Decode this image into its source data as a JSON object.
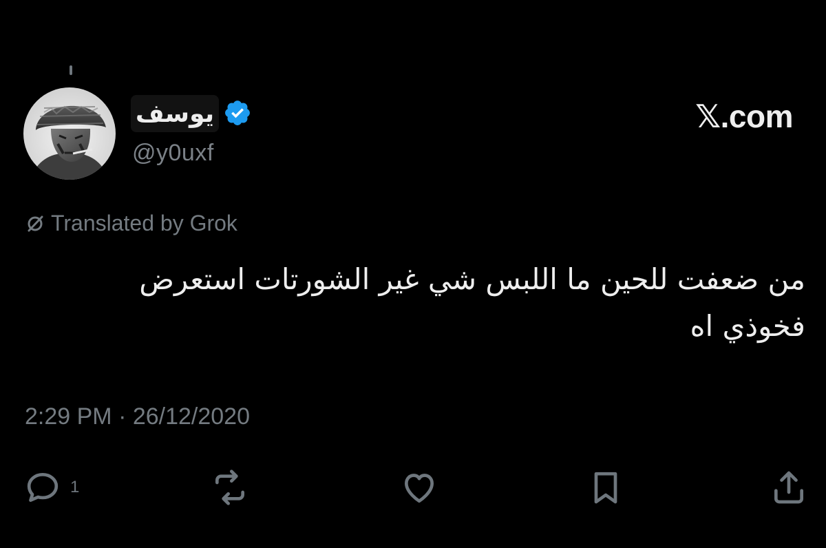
{
  "tweet": {
    "display_name": "يوسف",
    "handle": "@y0uxf",
    "verified": true,
    "brand": "𝕏.com",
    "translated_label": "Translated by Grok",
    "text": "من ضعفت للحين ما اللبس شي غير الشورتات استعرض فخوذي اه",
    "timestamp": "2:29 PM · 26/12/2020"
  },
  "actions": {
    "reply_icon": "reply-icon",
    "reply_count": "1",
    "retweet_icon": "retweet-icon",
    "like_icon": "heart-icon",
    "bookmark_icon": "bookmark-icon",
    "share_icon": "share-icon"
  },
  "colors": {
    "background": "#000000",
    "text_primary": "#eeeeee",
    "text_secondary": "#747b81",
    "verified_blue": "#1d9bf0"
  }
}
